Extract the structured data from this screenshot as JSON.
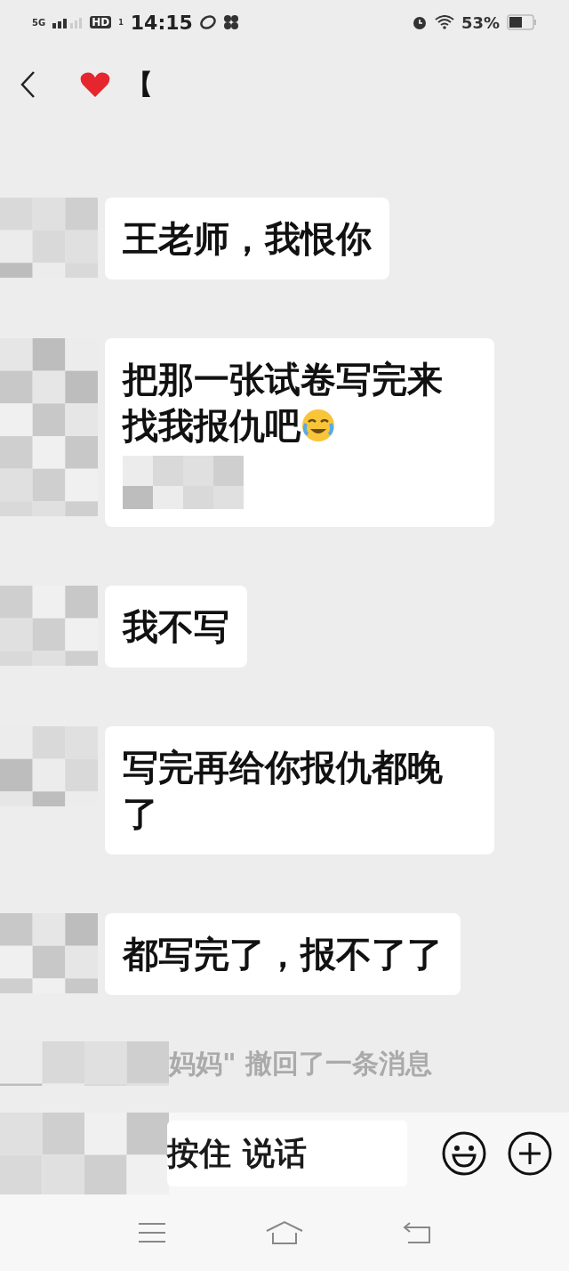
{
  "status_bar": {
    "network": "5G",
    "hd": "HD",
    "sim": "1",
    "time": "14:15",
    "battery": "53%"
  },
  "header": {
    "title": "【"
  },
  "messages": [
    {
      "kind": "text",
      "text": "王老师，我恨你"
    },
    {
      "kind": "text_emoji",
      "text": "把那一张试卷写完来找我报仇吧"
    },
    {
      "kind": "text",
      "text": "我不写"
    },
    {
      "kind": "text",
      "text": "写完再给你报仇都晚了"
    },
    {
      "kind": "text",
      "text": "都写完了，报不了了"
    }
  ],
  "notice": {
    "text": "妈妈\" 撤回了一条消息"
  },
  "input_bar": {
    "voice_button": "按住 说话"
  }
}
